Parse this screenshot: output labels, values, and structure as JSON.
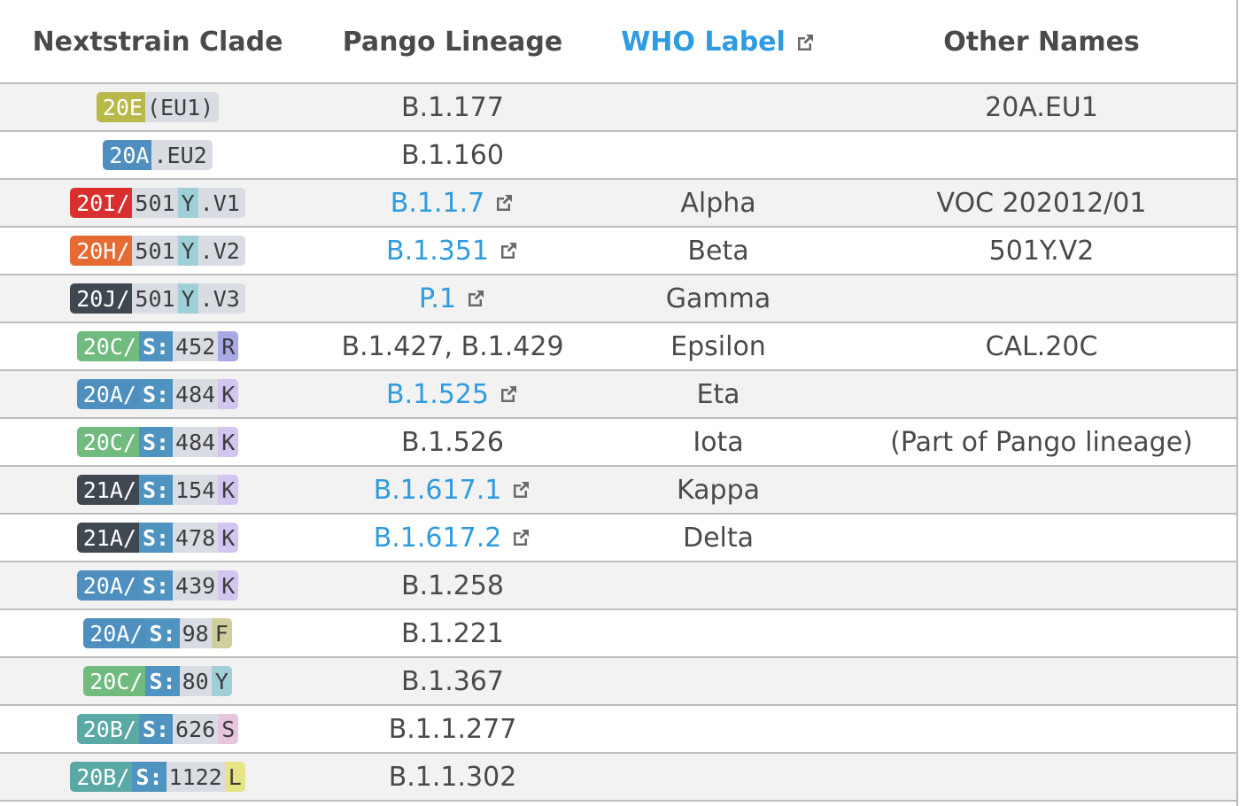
{
  "header": {
    "col1": "Nextstrain Clade",
    "col2": "Pango Lineage",
    "col3": "WHO Label",
    "col4": "Other Names"
  },
  "colors": {
    "link": "#2f9be0",
    "row_odd": "#f2f2f2",
    "row_even": "#ffffff",
    "border": "#bdbdbd"
  },
  "rows": [
    {
      "clade": {
        "type": "plain",
        "label": "20E",
        "rest": " (EU1)",
        "color": "#b8b94a"
      },
      "pango": "B.1.177",
      "pango_link": false,
      "who": "",
      "other": "20A.EU1"
    },
    {
      "clade": {
        "type": "plain",
        "label": "20A",
        "rest": ".EU2",
        "color": "#4e8fc0"
      },
      "pango": "B.1.160",
      "pango_link": false,
      "who": "",
      "other": ""
    },
    {
      "clade": {
        "type": "voc",
        "label": "20I/",
        "pos": "501",
        "aa": "Y",
        "rest": ".V1",
        "color": "#d9302f",
        "aa_color": "#9fd0d7"
      },
      "pango": "B.1.1.7",
      "pango_link": true,
      "who": "Alpha",
      "other": "VOC 202012/01"
    },
    {
      "clade": {
        "type": "voc",
        "label": "20H/",
        "pos": "501",
        "aa": "Y",
        "rest": ".V2",
        "color": "#e66a34",
        "aa_color": "#9fd0d7"
      },
      "pango": "B.1.351",
      "pango_link": true,
      "who": "Beta",
      "other": "501Y.V2"
    },
    {
      "clade": {
        "type": "voc",
        "label": "20J/",
        "pos": "501",
        "aa": "Y",
        "rest": ".V3",
        "color": "#3f4750",
        "aa_color": "#9fd0d7"
      },
      "pango": "P.1",
      "pango_link": true,
      "who": "Gamma",
      "other": ""
    },
    {
      "clade": {
        "type": "spike",
        "label": "20C/",
        "gene": "S:",
        "pos": "452",
        "aa": "R",
        "color": "#72bb7f",
        "aa_color": "#a8a9e6"
      },
      "pango": "B.1.427, B.1.429",
      "pango_link": false,
      "who": "Epsilon",
      "other": "CAL.20C"
    },
    {
      "clade": {
        "type": "spike",
        "label": "20A/",
        "gene": "S:",
        "pos": "484",
        "aa": "K",
        "color": "#4e8fc0",
        "aa_color": "#d2c6ef"
      },
      "pango": "B.1.525",
      "pango_link": true,
      "who": "Eta",
      "other": ""
    },
    {
      "clade": {
        "type": "spike",
        "label": "20C/",
        "gene": "S:",
        "pos": "484",
        "aa": "K",
        "color": "#72bb7f",
        "aa_color": "#d2c6ef"
      },
      "pango": "B.1.526",
      "pango_link": false,
      "who": "Iota",
      "other": "(Part of Pango lineage)"
    },
    {
      "clade": {
        "type": "spike",
        "label": "21A/",
        "gene": "S:",
        "pos": "154",
        "aa": "K",
        "color": "#3f4750",
        "aa_color": "#d2c6ef"
      },
      "pango": "B.1.617.1",
      "pango_link": true,
      "who": "Kappa",
      "other": ""
    },
    {
      "clade": {
        "type": "spike",
        "label": "21A/",
        "gene": "S:",
        "pos": "478",
        "aa": "K",
        "color": "#3f4750",
        "aa_color": "#d2c6ef"
      },
      "pango": "B.1.617.2",
      "pango_link": true,
      "who": "Delta",
      "other": ""
    },
    {
      "clade": {
        "type": "spike",
        "label": "20A/",
        "gene": "S:",
        "pos": "439",
        "aa": "K",
        "color": "#4e8fc0",
        "aa_color": "#d2c6ef"
      },
      "pango": "B.1.258",
      "pango_link": false,
      "who": "",
      "other": ""
    },
    {
      "clade": {
        "type": "spike",
        "label": "20A/",
        "gene": "S:",
        "pos": "98",
        "aa": "F",
        "color": "#4e8fc0",
        "aa_color": "#cfcf9d"
      },
      "pango": "B.1.221",
      "pango_link": false,
      "who": "",
      "other": ""
    },
    {
      "clade": {
        "type": "spike",
        "label": "20C/",
        "gene": "S:",
        "pos": "80",
        "aa": "Y",
        "color": "#72bb7f",
        "aa_color": "#9fd0d7"
      },
      "pango": "B.1.367",
      "pango_link": false,
      "who": "",
      "other": ""
    },
    {
      "clade": {
        "type": "spike",
        "label": "20B/",
        "gene": "S:",
        "pos": "626",
        "aa": "S",
        "color": "#5aa9a5",
        "aa_color": "#e7c6dd"
      },
      "pango": "B.1.1.277",
      "pango_link": false,
      "who": "",
      "other": ""
    },
    {
      "clade": {
        "type": "spike",
        "label": "20B/",
        "gene": "S:",
        "pos": "1122",
        "aa": "L",
        "color": "#5aa9a5",
        "aa_color": "#e6e483"
      },
      "pango": "B.1.1.302",
      "pango_link": false,
      "who": "",
      "other": ""
    }
  ]
}
